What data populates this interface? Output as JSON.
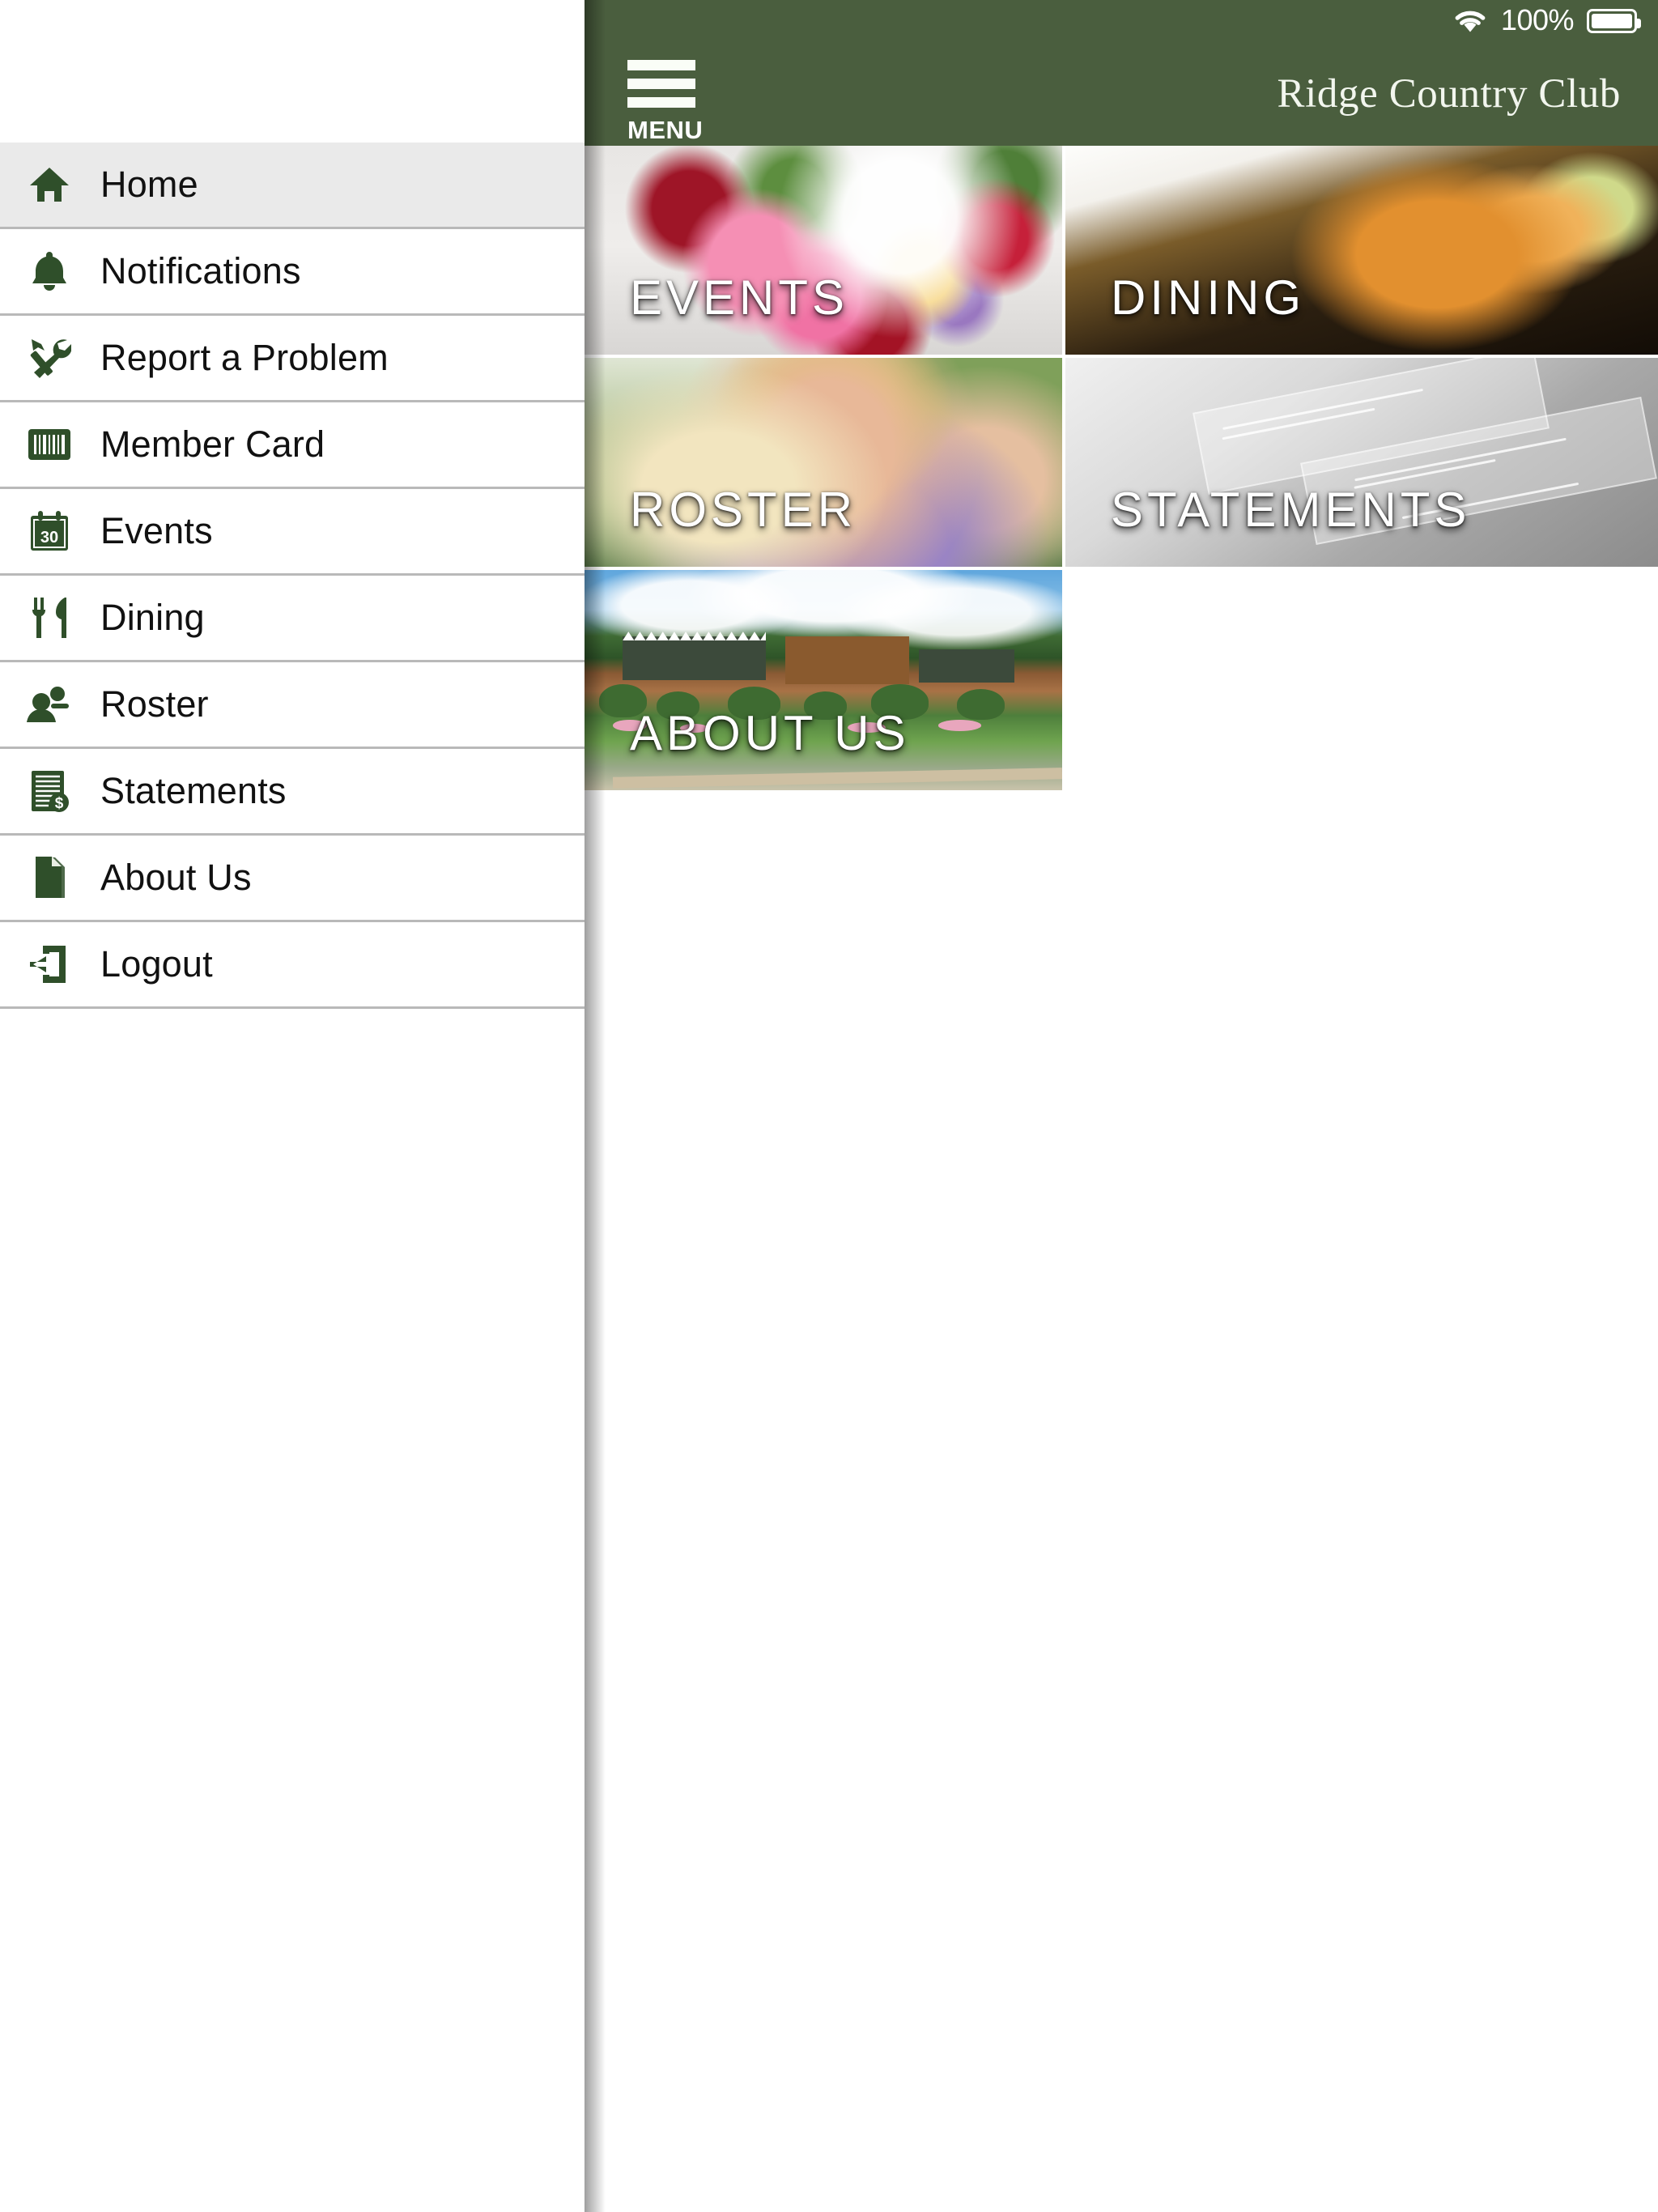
{
  "status_bar": {
    "wifi_icon": "wifi-icon",
    "battery_percent": "100%",
    "battery_icon": "battery-full-icon"
  },
  "header": {
    "menu_button_label": "MENU",
    "menu_icon": "hamburger-menu-icon",
    "title": "Ridge Country Club",
    "background_color": "#4a5e3e"
  },
  "sidebar": {
    "background_color": "#ffffff",
    "icon_color": "#2f4f2a",
    "active_background": "#eaeaea",
    "items": [
      {
        "label": "Home",
        "icon": "home-icon",
        "active": true
      },
      {
        "label": "Notifications",
        "icon": "bell-icon",
        "active": false
      },
      {
        "label": "Report a Problem",
        "icon": "tools-icon",
        "active": false
      },
      {
        "label": "Member Card",
        "icon": "barcode-icon",
        "active": false
      },
      {
        "label": "Events",
        "icon": "calendar-30-icon",
        "active": false
      },
      {
        "label": "Dining",
        "icon": "fork-knife-icon",
        "active": false
      },
      {
        "label": "Roster",
        "icon": "people-icon",
        "active": false
      },
      {
        "label": "Statements",
        "icon": "invoice-dollar-icon",
        "active": false
      },
      {
        "label": "About Us",
        "icon": "document-icon",
        "active": false
      },
      {
        "label": "Logout",
        "icon": "logout-arrow-icon",
        "active": false
      }
    ]
  },
  "home_tiles": [
    {
      "label": "EVENTS",
      "art": "banquet-table-flowers"
    },
    {
      "label": "DINING",
      "art": "plated-entree"
    },
    {
      "label": "ROSTER",
      "art": "golfers-group"
    },
    {
      "label": "STATEMENTS",
      "art": "paper-statements"
    },
    {
      "label": "ABOUT US",
      "art": "clubhouse-exterior"
    }
  ]
}
